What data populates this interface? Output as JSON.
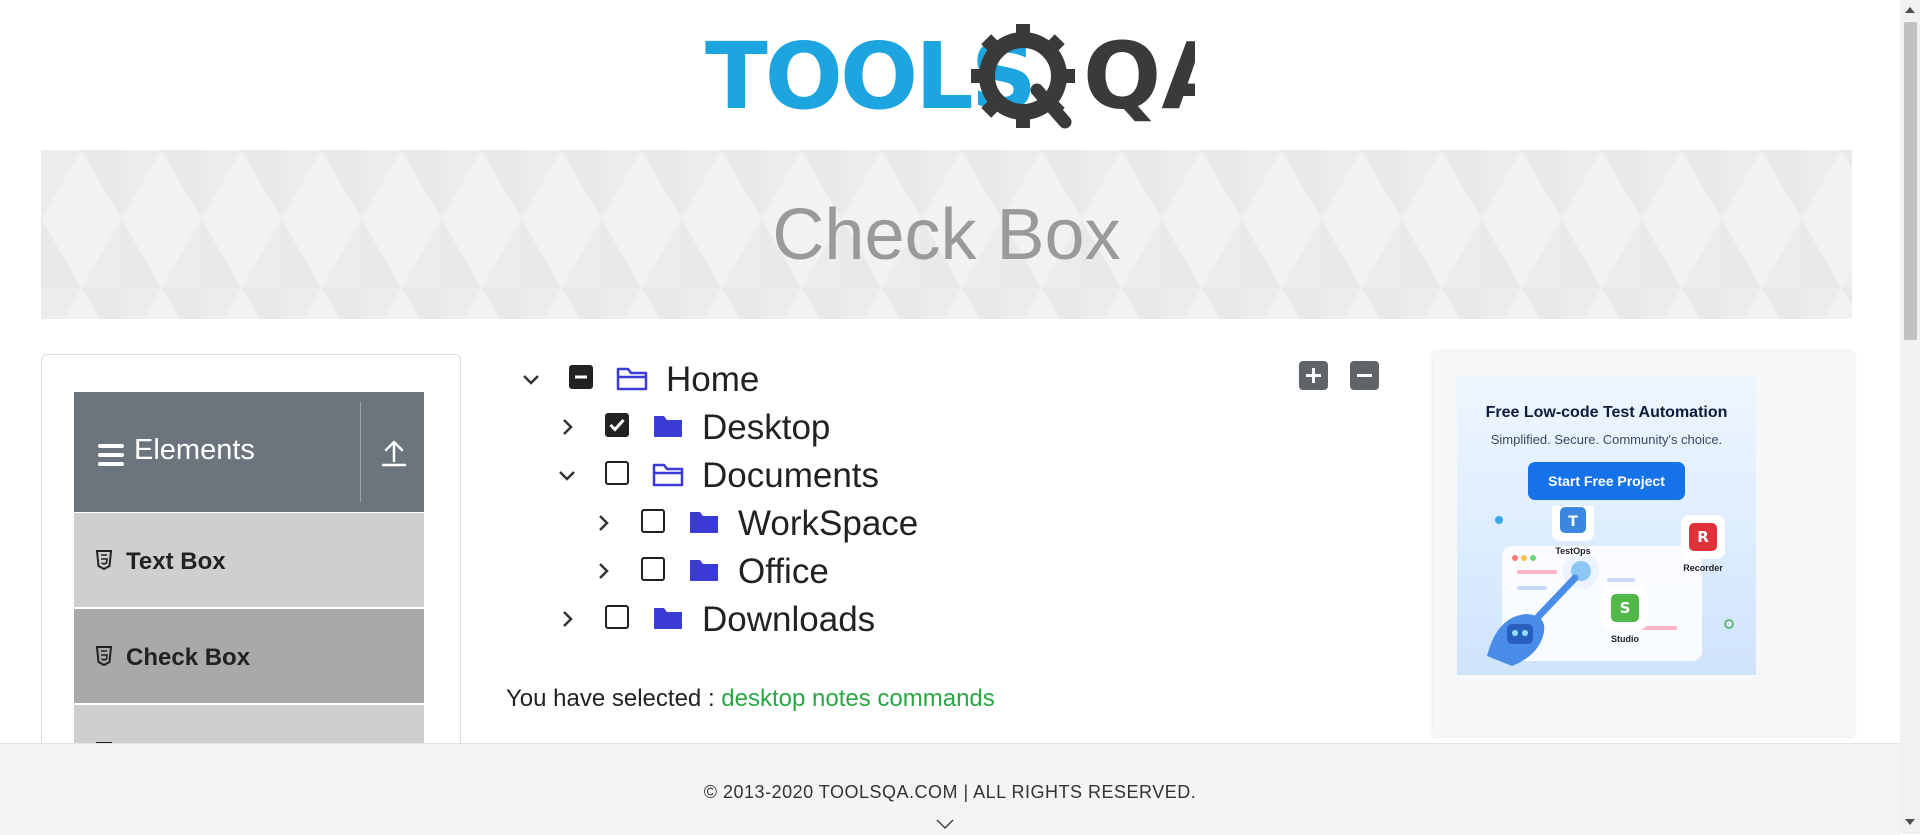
{
  "header": {
    "logo_text_left": "TOOLS",
    "logo_text_right": "QA"
  },
  "banner": {
    "title": "Check Box"
  },
  "sidebar": {
    "group_label": "Elements",
    "items": [
      {
        "label": "Text Box",
        "active": false
      },
      {
        "label": "Check Box",
        "active": true
      },
      {
        "label": "",
        "active": false
      }
    ]
  },
  "tree": {
    "nodes": [
      {
        "label": "Home",
        "expanded": true,
        "state": "half",
        "folder": "open",
        "depth": 0
      },
      {
        "label": "Desktop",
        "expanded": false,
        "state": "checked",
        "folder": "closed",
        "depth": 1
      },
      {
        "label": "Documents",
        "expanded": true,
        "state": "unchecked",
        "folder": "open",
        "depth": 1
      },
      {
        "label": "WorkSpace",
        "expanded": false,
        "state": "unchecked",
        "folder": "closed",
        "depth": 2
      },
      {
        "label": "Office",
        "expanded": false,
        "state": "unchecked",
        "folder": "closed",
        "depth": 2
      },
      {
        "label": "Downloads",
        "expanded": false,
        "state": "unchecked",
        "folder": "closed",
        "depth": 1
      }
    ],
    "expand_all_icon": "plus-icon",
    "collapse_all_icon": "minus-icon"
  },
  "result": {
    "prefix": "You have selected :",
    "items": "desktop notes commands"
  },
  "ad": {
    "title": "Free Low-code Test Automation",
    "subtitle": "Simplified. Secure. Community's choice.",
    "button": "Start Free Project",
    "labels": [
      "TestOps",
      "Recorder",
      "Studio"
    ]
  },
  "footer": {
    "copyright": "© 2013-2020 TOOLSQA.COM | ALL RIGHTS RESERVED."
  },
  "colors": {
    "accent_blue": "#1da5e0",
    "folder_blue": "#3b3bd6",
    "selected_green": "#28a745",
    "sidebar_header": "#6c757d"
  }
}
